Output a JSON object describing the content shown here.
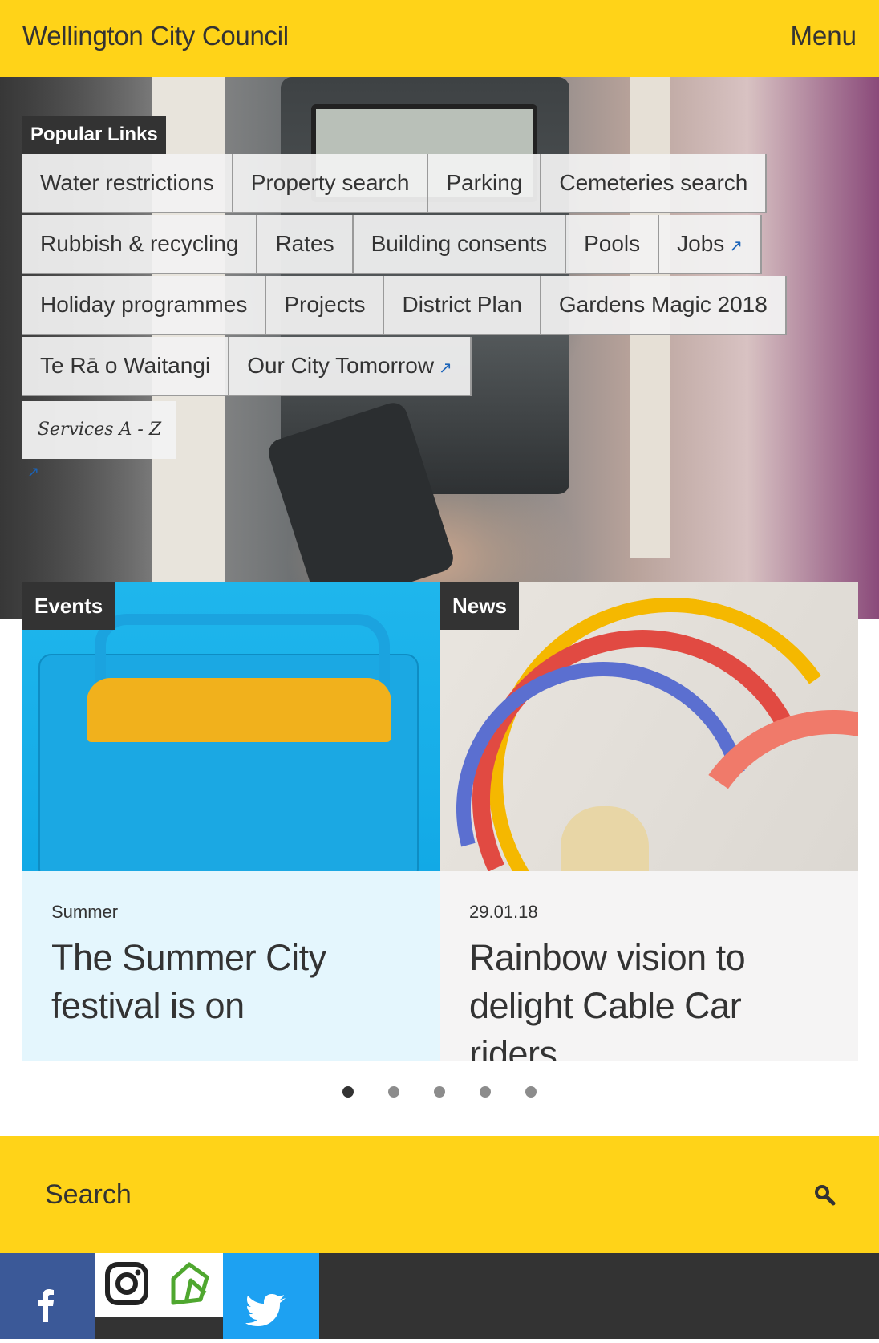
{
  "header": {
    "site_title": "Wellington City Council",
    "menu_label": "Menu"
  },
  "popular_links": {
    "heading": "Popular Links",
    "rows": [
      [
        {
          "label": "Water restrictions"
        },
        {
          "label": "Property search"
        },
        {
          "label": "Parking"
        },
        {
          "label": "Cemeteries search"
        }
      ],
      [
        {
          "label": "Rubbish & recycling"
        },
        {
          "label": "Rates"
        },
        {
          "label": "Building consents"
        },
        {
          "label": "Pools"
        },
        {
          "label": "Jobs",
          "external": true
        }
      ],
      [
        {
          "label": "Holiday programmes"
        },
        {
          "label": "Projects"
        },
        {
          "label": "District Plan"
        },
        {
          "label": "Gardens Magic 2018"
        }
      ],
      [
        {
          "label": "Te Rā o Waitangi"
        },
        {
          "label": "Our City Tomorrow",
          "external": true
        }
      ]
    ],
    "services_label": "Services A - Z",
    "external_glyph": "↗"
  },
  "cards": {
    "events": {
      "tag": "Events",
      "meta": "Summer",
      "title": "The Summer City festival is on"
    },
    "news": {
      "tag": "News",
      "meta": "29.01.18",
      "title": "Rainbow vision to delight Cable Car riders"
    }
  },
  "carousel": {
    "dot_count": 5,
    "active_index": 0
  },
  "search": {
    "placeholder": "Search",
    "icon": "search-icon"
  },
  "social": [
    {
      "name": "facebook-icon",
      "color": "#3b5998"
    },
    {
      "name": "instagram-icon",
      "color": "#ffffff"
    },
    {
      "name": "gw-logo-icon",
      "color": "#ffffff"
    },
    {
      "name": "twitter-icon",
      "color": "#1da1f2"
    }
  ],
  "colors": {
    "brand_yellow": "#ffd318",
    "dark": "#333333",
    "link_blue": "#1a63b8"
  }
}
